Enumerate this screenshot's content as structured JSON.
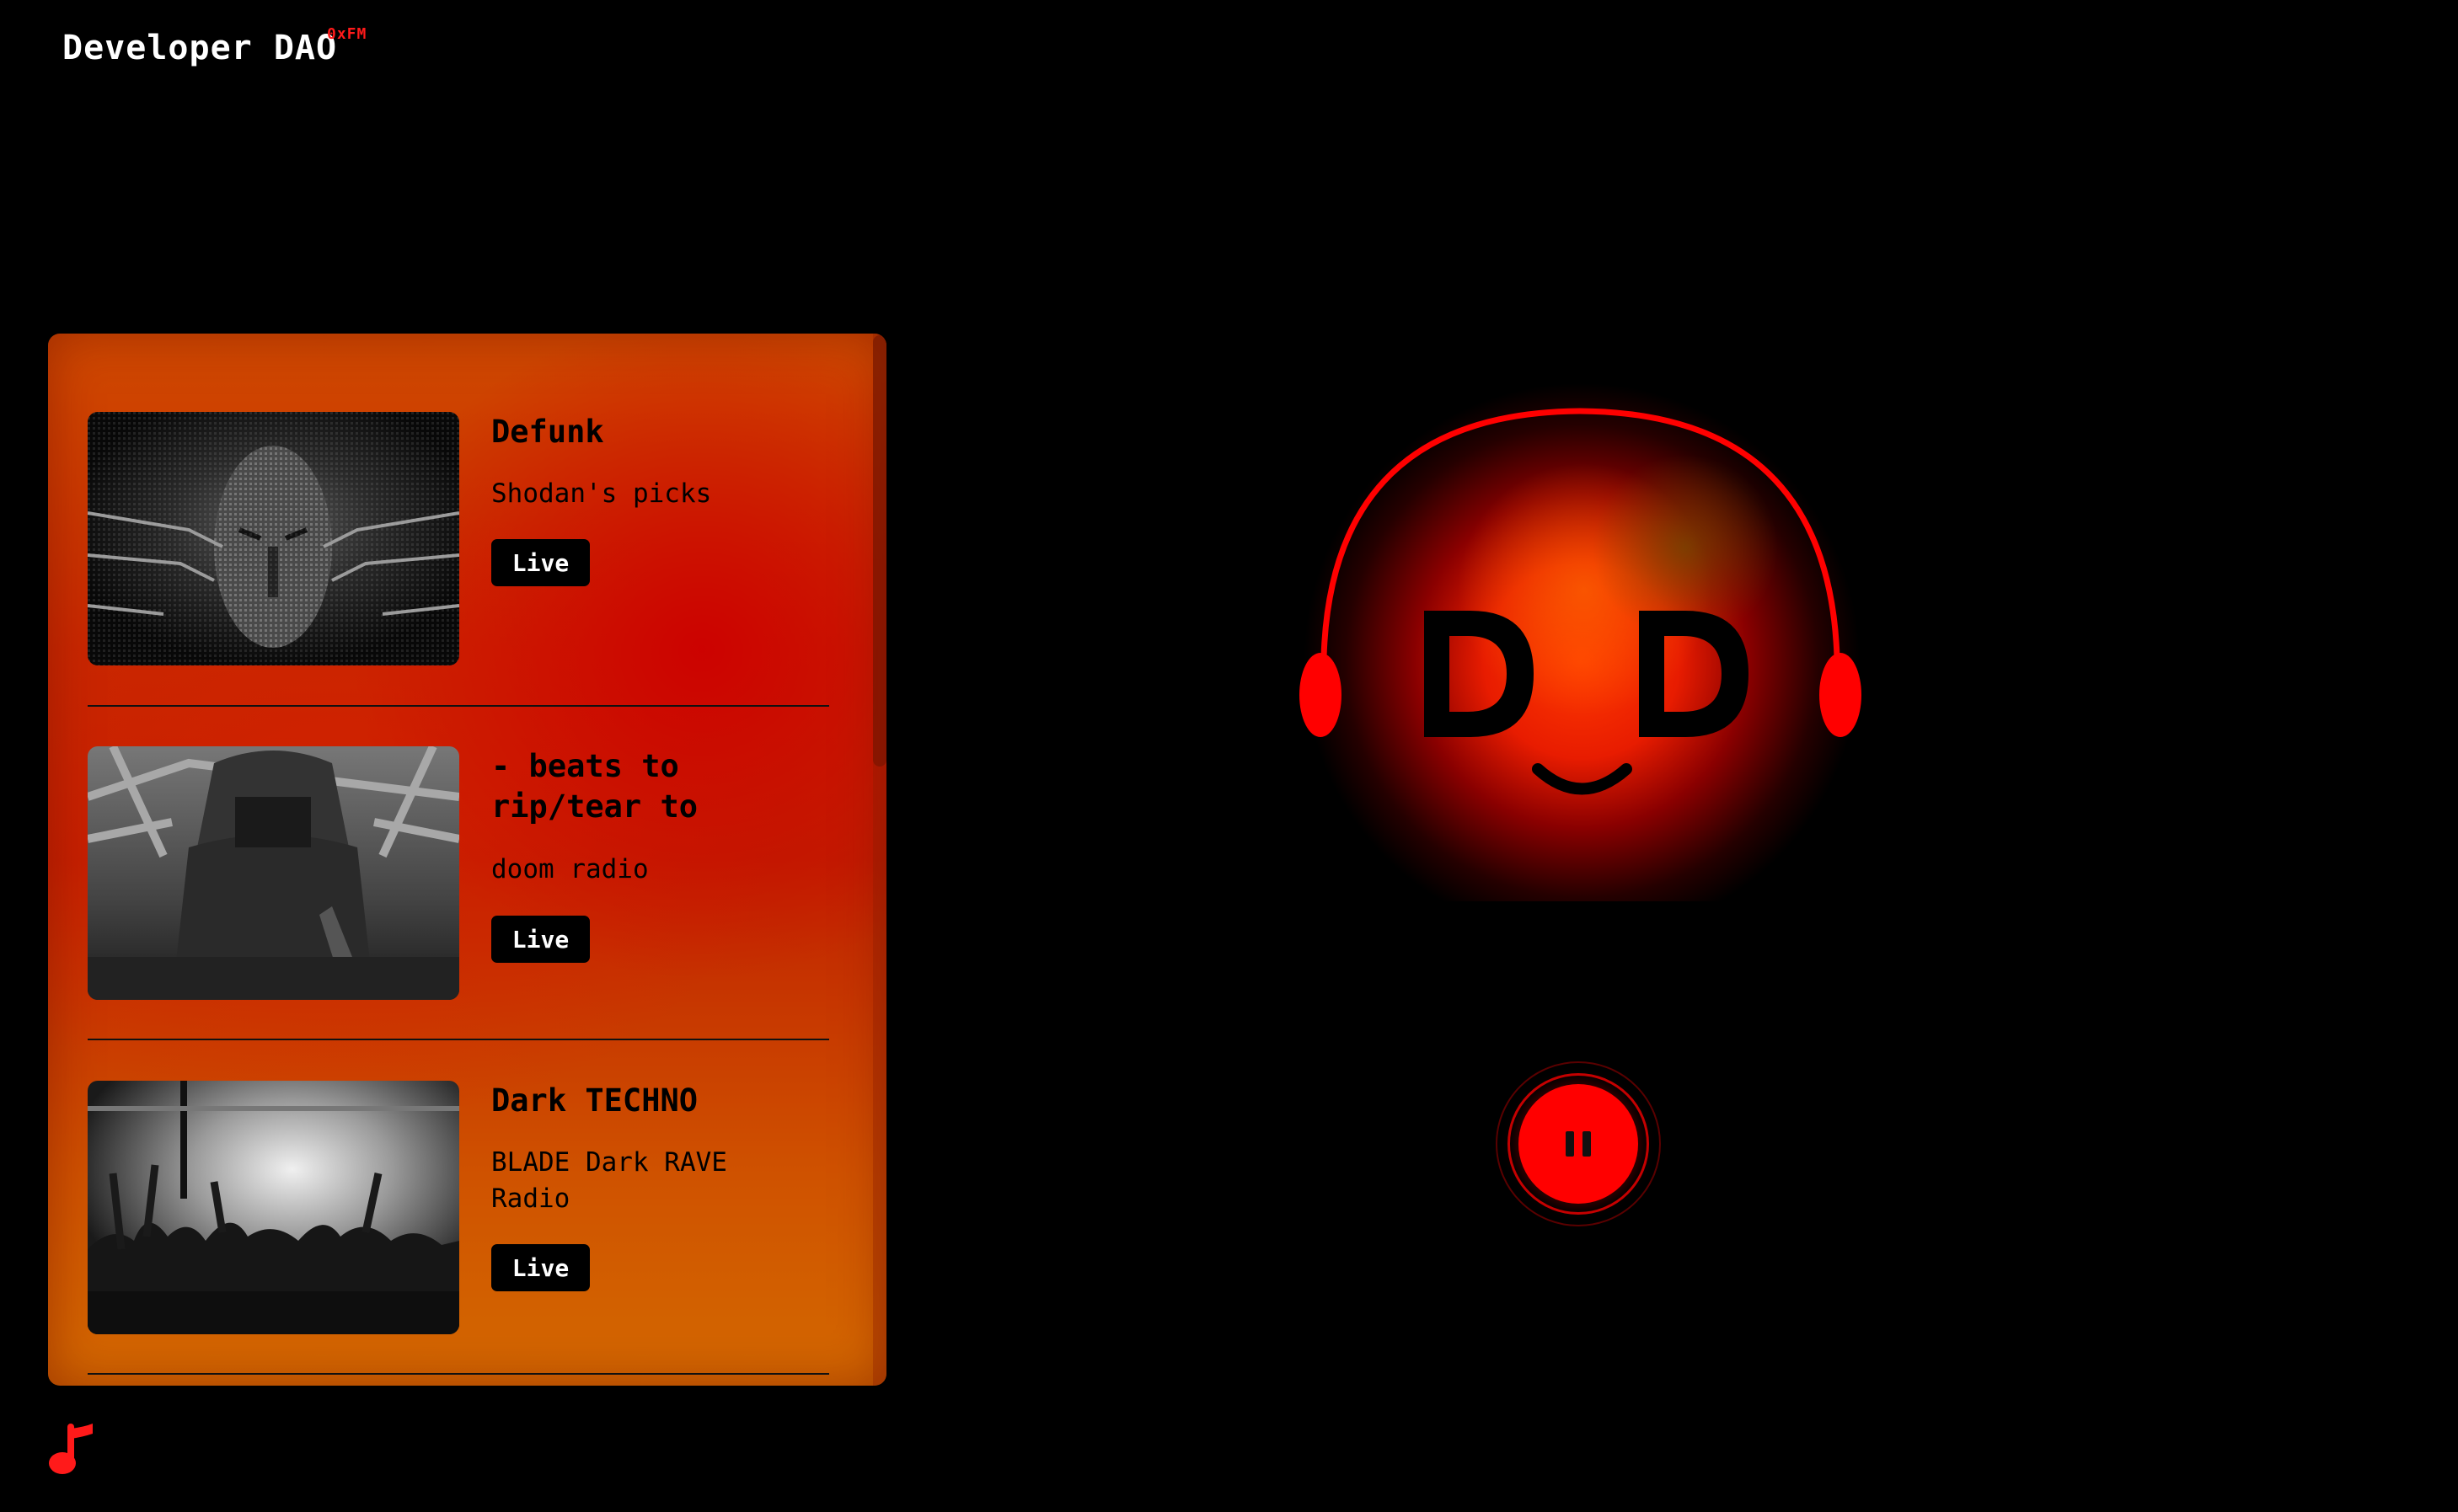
{
  "header": {
    "title": "Developer DAO",
    "badge": "0xFM"
  },
  "stations": [
    {
      "title": "Defunk",
      "subtitle": "Shodan's picks",
      "status": "Live"
    },
    {
      "title": "- beats to rip/tear to",
      "subtitle": "doom radio",
      "status": "Live"
    },
    {
      "title": "Dark TECHNO",
      "subtitle": "BLADE Dark RAVE Radio",
      "status": "Live"
    }
  ],
  "player": {
    "state": "playing",
    "control_icon": "pause-icon"
  },
  "icons": {
    "bottom_left": "music-note-icon",
    "mascot": "headphones-face-icon"
  },
  "colors": {
    "accent": "#ff0000",
    "background": "#000000",
    "panel_orange": "#d05a00",
    "panel_red": "#c81400",
    "text_dark": "#000000",
    "text_light": "#ffffff"
  }
}
